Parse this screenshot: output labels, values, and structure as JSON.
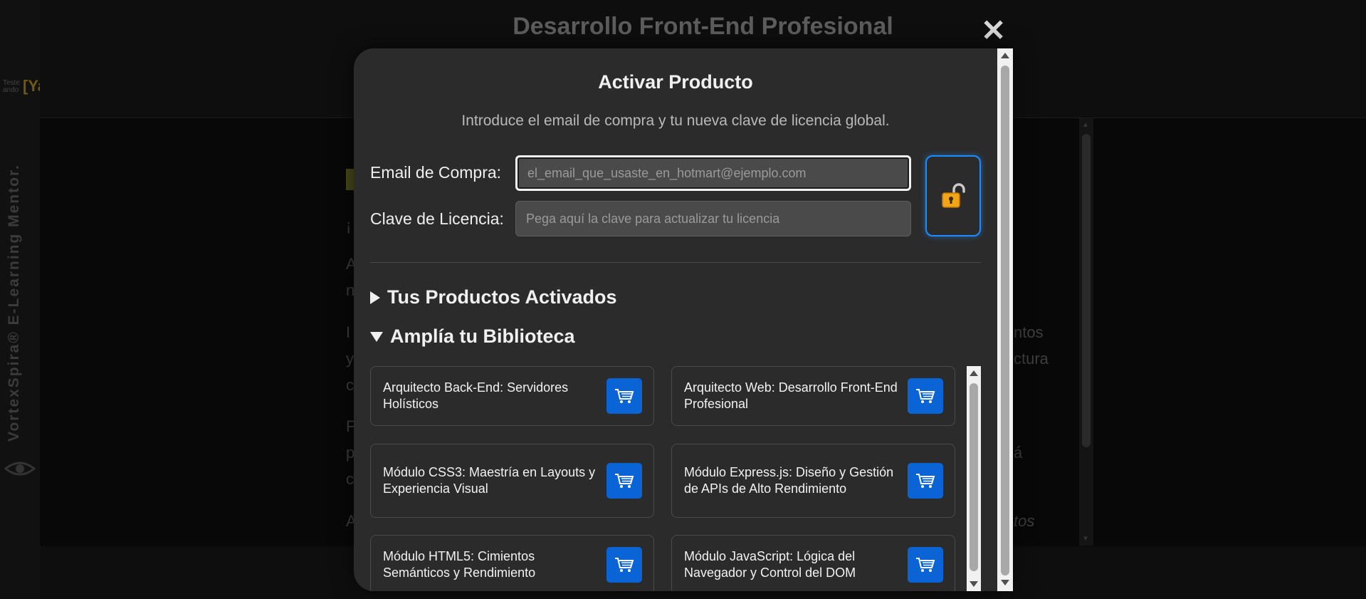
{
  "background": {
    "page_title": "Desarrollo Front-End Profesional",
    "logo_small": "Teste ando",
    "logo_ya": "[Ya]",
    "brand_vertical": "VortexSpira® E-Learning Mentor.",
    "text_fragments": {
      "frag1": "¡",
      "frag2": "A",
      "frag3": "n",
      "frag4": "I",
      "frag5": "y",
      "frag6": "c",
      "frag7": "F",
      "frag8": "p",
      "frag9": "c",
      "frag10": "A",
      "frag11": "ntos",
      "frag12": "ctura",
      "frag13": "á",
      "frag14": "tos"
    }
  },
  "modal": {
    "title": "Activar Producto",
    "subtitle": "Introduce el email de compra y tu nueva clave de licencia global.",
    "email_label": "Email de Compra:",
    "email_placeholder": "el_email_que_usaste_en_hotmart@ejemplo.com",
    "email_value": "",
    "key_label": "Clave de Licencia:",
    "key_placeholder": "Pega aquí la clave para actualizar tu licencia",
    "key_value": "",
    "activated_section": "Tus Productos Activados",
    "library_section": "Amplía tu Biblioteca",
    "products": [
      {
        "name": "Arquitecto Back-End: Servidores Holísticos"
      },
      {
        "name": "Arquitecto Web: Desarrollo Front-End Profesional"
      },
      {
        "name": "Módulo CSS3: Maestría en Layouts y Experiencia Visual"
      },
      {
        "name": "Módulo Express.js: Diseño y Gestión de APIs de Alto Rendimiento"
      },
      {
        "name": "Módulo HTML5: Cimientos Semánticos y Rendimiento"
      },
      {
        "name": "Módulo JavaScript: Lógica del Navegador y Control del DOM"
      }
    ]
  },
  "icons": {
    "close": "close-icon",
    "unlock": "unlock-icon",
    "cart": "cart-icon"
  },
  "colors": {
    "accent_blue": "#0a64d6",
    "focus_ring": "#1e8bff",
    "modal_bg": "#2b2b2b"
  }
}
